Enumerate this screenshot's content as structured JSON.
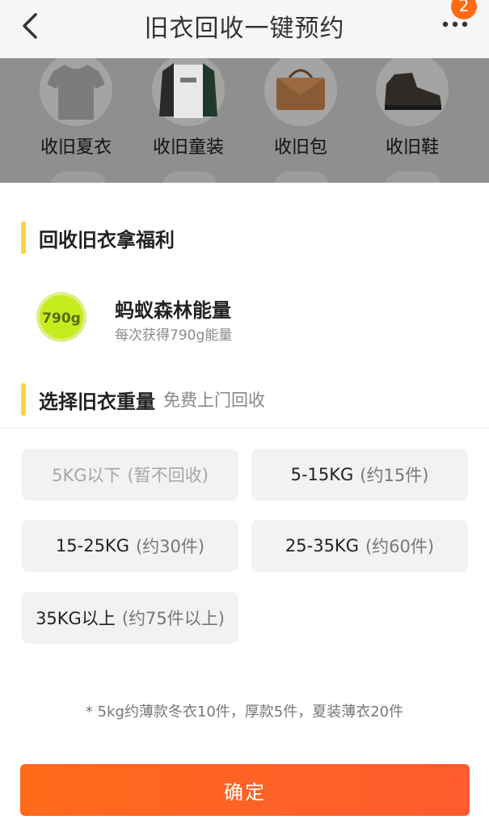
{
  "header": {
    "title": "旧衣回收一键预约",
    "badge": "2",
    "back_icon": "chevron-left-icon",
    "more_icon": "more-dots-icon"
  },
  "categories": [
    {
      "label": "收旧夏衣",
      "icon": "tshirt-icon"
    },
    {
      "label": "收旧童装",
      "icon": "jacket-icon"
    },
    {
      "label": "收旧包",
      "icon": "handbag-icon"
    },
    {
      "label": "收旧鞋",
      "icon": "shoe-icon"
    }
  ],
  "benefit_section": {
    "title": "回收旧衣拿福利",
    "item": {
      "badge_text": "790g",
      "name": "蚂蚁森林能量",
      "desc": "每次获得790g能量"
    }
  },
  "weight_section": {
    "title": "选择旧衣重量",
    "subtitle": "免费上门回收",
    "options": [
      {
        "main": "5KG以下",
        "sub": "(暂不回收)",
        "disabled": true
      },
      {
        "main": "5-15KG",
        "sub": "(约15件)",
        "disabled": false
      },
      {
        "main": "15-25KG",
        "sub": "(约30件)",
        "disabled": false
      },
      {
        "main": "25-35KG",
        "sub": "(约60件)",
        "disabled": false
      },
      {
        "main": "35KG以上",
        "sub": "(约75件以上)",
        "disabled": false
      }
    ],
    "footnote": "* 5kg约薄款冬衣10件，厚款5件，夏装薄衣20件"
  },
  "confirm_label": "确定",
  "colors": {
    "accent": "#ff6a1a",
    "section_bar": "#ffd43b",
    "badge": "#ff6a13",
    "energy_ball": "#c6ec1f"
  }
}
